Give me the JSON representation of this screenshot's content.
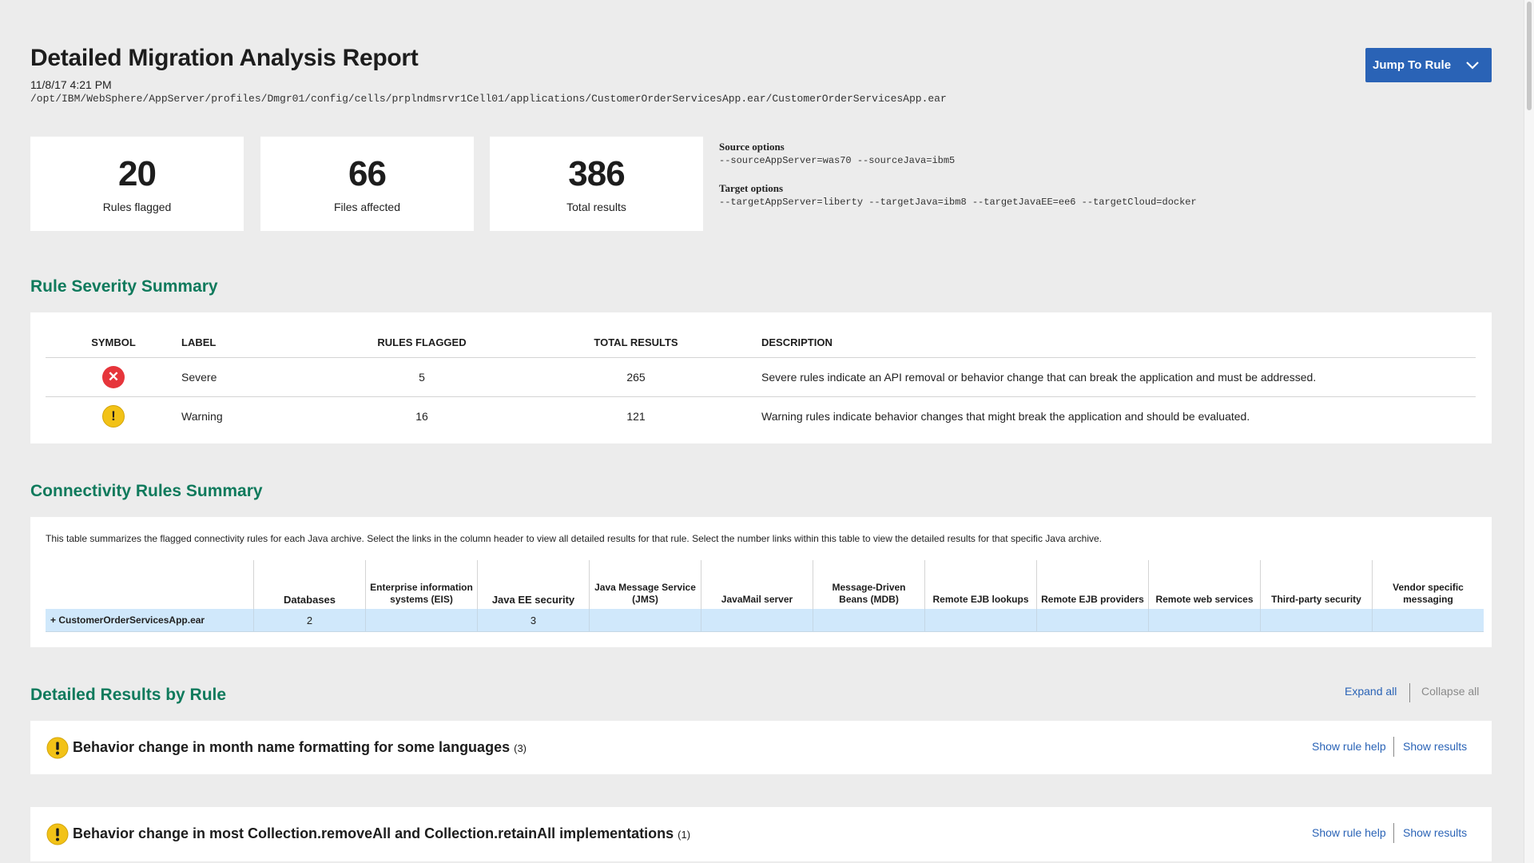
{
  "header": {
    "title": "Detailed Migration Analysis Report",
    "date": "11/8/17 4:21 PM",
    "path": "/opt/IBM/WebSphere/AppServer/profiles/Dmgr01/config/cells/prplndmsrvr1Cell01/applications/CustomerOrderServicesApp.ear/CustomerOrderServicesApp.ear",
    "jump_button": "Jump To Rule"
  },
  "stats": [
    {
      "value": "20",
      "label": "Rules flagged"
    },
    {
      "value": "66",
      "label": "Files affected"
    },
    {
      "value": "386",
      "label": "Total results"
    }
  ],
  "options": {
    "source_heading": "Source options",
    "source_value": "--sourceAppServer=was70 --sourceJava=ibm5",
    "target_heading": "Target options",
    "target_value": "--targetAppServer=liberty --targetJava=ibm8 --targetJavaEE=ee6 --targetCloud=docker"
  },
  "severity": {
    "heading": "Rule Severity Summary",
    "columns": [
      "Symbol",
      "Label",
      "Rules flagged",
      "Total results",
      "Description"
    ],
    "rows": [
      {
        "icon": "severe-icon",
        "label": "Severe",
        "rules_flagged": "5",
        "total_results": "265",
        "description": "Severe rules indicate an API removal or behavior change that can break the application and must be addressed."
      },
      {
        "icon": "warning-icon",
        "label": "Warning",
        "rules_flagged": "16",
        "total_results": "121",
        "description": "Warning rules indicate behavior changes that might break the application and should be evaluated."
      }
    ],
    "colors": {
      "severe": "#e6353b",
      "warning": "#f2c217"
    }
  },
  "connectivity": {
    "heading": "Connectivity Rules Summary",
    "description": "This table summarizes the flagged connectivity rules for each Java archive. Select the links in the column header to view all detailed results for that rule. Select the number links within this table to view the detailed results for that specific Java archive.",
    "columns": [
      "Databases",
      "Enterprise information systems (EIS)",
      "Java EE security",
      "Java Message Service (JMS)",
      "JavaMail server",
      "Message-Driven Beans (MDB)",
      "Remote EJB lookups",
      "Remote EJB providers",
      "Remote web services",
      "Third-party security",
      "Vendor specific messaging"
    ],
    "rows": [
      {
        "archive": "+ CustomerOrderServicesApp.ear",
        "values": [
          "2",
          "",
          "3",
          "",
          "",
          "",
          "",
          "",
          "",
          "",
          ""
        ]
      }
    ]
  },
  "detailed": {
    "heading": "Detailed Results by Rule",
    "expand_all": "Expand all",
    "collapse_all": "Collapse all",
    "rules": [
      {
        "title": "Behavior change in month name formatting for some languages",
        "count": "(3)",
        "severity": "warning",
        "help_link": "Show rule help",
        "results_link": "Show results"
      },
      {
        "title": "Behavior change in most Collection.removeAll and Collection.retainAll implementations",
        "count": "(1)",
        "severity": "warning",
        "help_link": "Show rule help",
        "results_link": "Show results"
      }
    ]
  },
  "accent_colors": {
    "heading_green": "#0f7a5c",
    "button_blue": "#2a63b6",
    "row_highlight": "#d0e8fb"
  }
}
